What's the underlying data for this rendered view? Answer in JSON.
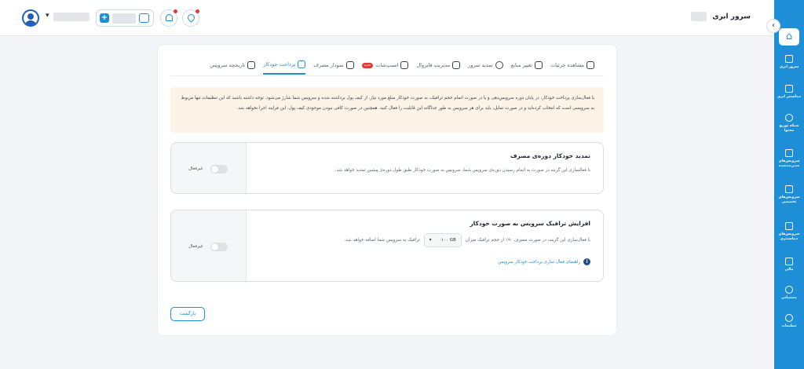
{
  "header": {
    "page_title": "سرور ابری"
  },
  "sidebar": {
    "items": [
      {
        "label": "سرور ابری",
        "icon": "server-icon"
      },
      {
        "label": "دیتاسنتر ابری",
        "icon": "datacenter-icon"
      },
      {
        "label": "شبکه توزیع محتوا",
        "icon": "cdn-icon"
      },
      {
        "label": "سرویس‌های مدیریت‌شده",
        "icon": "managed-services-icon"
      },
      {
        "label": "سرویس‌های تخصصی",
        "icon": "special-services-icon"
      },
      {
        "label": "سرویس‌های دیتاسنتری",
        "icon": "datacenter-services-icon"
      },
      {
        "label": "مالی",
        "icon": "finance-icon"
      },
      {
        "label": "پشتیبانی",
        "icon": "support-icon"
      },
      {
        "label": "تنظیمات",
        "icon": "settings-icon"
      }
    ]
  },
  "tabs": [
    {
      "label": "مشاهده جزئیات",
      "icon": "details-icon"
    },
    {
      "label": "تغییر منابع",
      "icon": "resources-icon"
    },
    {
      "label": "تمدید سرور",
      "icon": "renew-icon"
    },
    {
      "label": "مدیریت فایروال",
      "icon": "firewall-icon"
    },
    {
      "label": "اسنپ‌شات",
      "icon": "snapshot-icon",
      "badge": "جدید"
    },
    {
      "label": "نمودار مصرف",
      "icon": "chart-icon"
    },
    {
      "label": "پرداخت خودکار",
      "icon": "autopay-icon",
      "active": true
    },
    {
      "label": "تاریخچه سرویس",
      "icon": "history-icon"
    }
  ],
  "warning": {
    "text": "با فعال‌سازی پرداخت خودکار، در پایان دوره سرویس‌دهی و یا در صورت اتمام حجم ترافیک، به صورت خودکار مبلغ مورد نیاز، از کیف پول برداشته شده و سرویس شما شارژ می‌شود. توجه داشته باشید که این تنظیمات تنها مربوط به سرویسی است که انتخاب کرده‌اید و در صورت تمایل، باید برای هر سرویس به طور جداگانه این قابلیت را فعال کنید. همچنین در صورت کافی نبودن موجودی کیف پول، این فرایند اجرا نخواهد شد."
  },
  "auto_renew": {
    "title": "تمدید خودکار دوره‌ی مصرف",
    "description": "با فعالسازی این گزینه در صورت به اتمام رسیدن دوره‌ی سرویس شما، سرویس به صورت خودکار طبق طول دوره‌ی پیشین تمدید خواهد شد.",
    "toggle_label": "غیرفعال",
    "enabled": false
  },
  "auto_traffic": {
    "title": "افزایش ترافیک سرویس به صورت خودکار",
    "desc_before": "با فعال‌سازی این گزینه، در صورت مصرف ۹۰٪ از حجم ترافیک میزان",
    "select_value": "۱۰۰ GB",
    "desc_after": "ترافیک به سرویس شما اضافه خواهد شد.",
    "guide_link": "راهنمای فعال سازی پرداخت خودکار سرویس",
    "toggle_label": "غیرفعال",
    "enabled": false
  },
  "back_button": "بازگشت",
  "colors": {
    "accent": "#1e8fd6",
    "warning_bg": "#fdf3e7",
    "badge_red": "#e53935"
  }
}
